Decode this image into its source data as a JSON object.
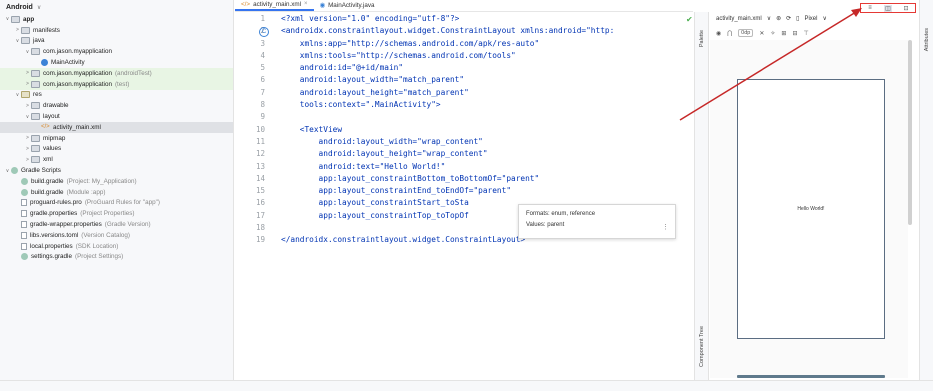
{
  "project": {
    "title": "Android",
    "items": [
      {
        "label": "app",
        "hint": "",
        "level": 0,
        "arrow": "∨",
        "icon": "folder",
        "bold": true,
        "state": ""
      },
      {
        "label": "manifests",
        "hint": "",
        "level": 1,
        "arrow": ">",
        "icon": "folder",
        "state": ""
      },
      {
        "label": "java",
        "hint": "",
        "level": 1,
        "arrow": "∨",
        "icon": "folder",
        "state": ""
      },
      {
        "label": "com.jason.myapplication",
        "hint": "",
        "level": 2,
        "arrow": "∨",
        "icon": "folder",
        "state": ""
      },
      {
        "label": "MainActivity",
        "hint": "",
        "level": 3,
        "arrow": "",
        "icon": "class",
        "state": ""
      },
      {
        "label": "com.jason.myapplication",
        "hint": "(androidTest)",
        "level": 2,
        "arrow": ">",
        "icon": "folder",
        "state": "green"
      },
      {
        "label": "com.jason.myapplication",
        "hint": "(test)",
        "level": 2,
        "arrow": ">",
        "icon": "folder",
        "state": "green"
      },
      {
        "label": "res",
        "hint": "",
        "level": 1,
        "arrow": "∨",
        "icon": "res",
        "state": ""
      },
      {
        "label": "drawable",
        "hint": "",
        "level": 2,
        "arrow": ">",
        "icon": "folder",
        "state": ""
      },
      {
        "label": "layout",
        "hint": "",
        "level": 2,
        "arrow": "∨",
        "icon": "folder",
        "state": ""
      },
      {
        "label": "activity_main.xml",
        "hint": "",
        "level": 3,
        "arrow": "",
        "icon": "xml",
        "state": "selected"
      },
      {
        "label": "mipmap",
        "hint": "",
        "level": 2,
        "arrow": ">",
        "icon": "folder",
        "state": ""
      },
      {
        "label": "values",
        "hint": "",
        "level": 2,
        "arrow": ">",
        "icon": "folder",
        "state": ""
      },
      {
        "label": "xml",
        "hint": "",
        "level": 2,
        "arrow": ">",
        "icon": "folder",
        "state": ""
      },
      {
        "label": "Gradle Scripts",
        "hint": "",
        "level": 0,
        "arrow": "∨",
        "icon": "gradle",
        "state": ""
      },
      {
        "label": "build.gradle",
        "hint": "(Project: My_Application)",
        "level": 1,
        "arrow": "",
        "icon": "gradle",
        "state": ""
      },
      {
        "label": "build.gradle",
        "hint": "(Module :app)",
        "level": 1,
        "arrow": "",
        "icon": "gradle",
        "state": ""
      },
      {
        "label": "proguard-rules.pro",
        "hint": "(ProGuard Rules for \"app\")",
        "level": 1,
        "arrow": "",
        "icon": "file",
        "state": ""
      },
      {
        "label": "gradle.properties",
        "hint": "(Project Properties)",
        "level": 1,
        "arrow": "",
        "icon": "file",
        "state": ""
      },
      {
        "label": "gradle-wrapper.properties",
        "hint": "(Gradle Version)",
        "level": 1,
        "arrow": "",
        "icon": "file",
        "state": ""
      },
      {
        "label": "libs.versions.toml",
        "hint": "(Version Catalog)",
        "level": 1,
        "arrow": "",
        "icon": "file",
        "state": ""
      },
      {
        "label": "local.properties",
        "hint": "(SDK Location)",
        "level": 1,
        "arrow": "",
        "icon": "file",
        "state": ""
      },
      {
        "label": "settings.gradle",
        "hint": "(Project Settings)",
        "level": 1,
        "arrow": "",
        "icon": "gradle",
        "state": ""
      }
    ]
  },
  "editor": {
    "tabs": [
      {
        "label": "activity_main.xml",
        "active": true,
        "icon": "xml-icon"
      },
      {
        "label": "MainActivity.java",
        "active": false,
        "icon": "java-class-icon"
      }
    ],
    "line_numbers": [
      "1",
      "2",
      "3",
      "4",
      "5",
      "6",
      "7",
      "8",
      "9",
      "10",
      "11",
      "12",
      "13",
      "14",
      "15",
      "16",
      "17",
      "18",
      "19"
    ],
    "lines": [
      {
        "text": "<?xml version=\"1.0\" encoding=\"utf-8\"?>"
      },
      {
        "text": "<androidx.constraintlayout.widget.ConstraintLayout xmlns:android=\"http:"
      },
      {
        "text": "    xmlns:app=\"http://schemas.android.com/apk/res-auto\""
      },
      {
        "text": "    xmlns:tools=\"http://schemas.android.com/tools\""
      },
      {
        "text": "    android:id=\"@+id/main\""
      },
      {
        "text": "    android:layout_width=\"match_parent\""
      },
      {
        "text": "    android:layout_height=\"match_parent\""
      },
      {
        "text": "    tools:context=\".MainActivity\">"
      },
      {
        "text": ""
      },
      {
        "text": "    <TextView"
      },
      {
        "text": "        android:layout_width=\"wrap_content\""
      },
      {
        "text": "        android:layout_height=\"wrap_content\""
      },
      {
        "text": "        android:text=\"Hello World!\""
      },
      {
        "text": "        app:layout_constraintBottom_toBottomOf=\"parent\""
      },
      {
        "text": "        app:layout_constraintEnd_toEndOf=\"parent\""
      },
      {
        "text": "        app:layout_constraintStart_toSta"
      },
      {
        "text": "        app:layout_constraintTop_toTopOf"
      },
      {
        "text": ""
      },
      {
        "text": "</androidx.constraintlayout.widget.ConstraintLayout>"
      }
    ],
    "gutter_badge": "C",
    "tooltip": {
      "formats": "Formats: enum, reference",
      "values": "Values: parent"
    }
  },
  "design": {
    "file_selector": "activity_main.xml",
    "pixel_label": "Pixel",
    "dp_label": "0dp",
    "palette_label": "Palette",
    "component_tree_label": "Component Tree",
    "attributes_label": "Attributes",
    "preview_text": "Hello World!",
    "view_modes": [
      "code-view-icon",
      "split-view-icon",
      "design-view-icon"
    ]
  },
  "colors": {
    "highlight_box": "#e53935",
    "arrow": "#c62828",
    "accent": "#3574f0",
    "keyword": "#0033b3"
  }
}
